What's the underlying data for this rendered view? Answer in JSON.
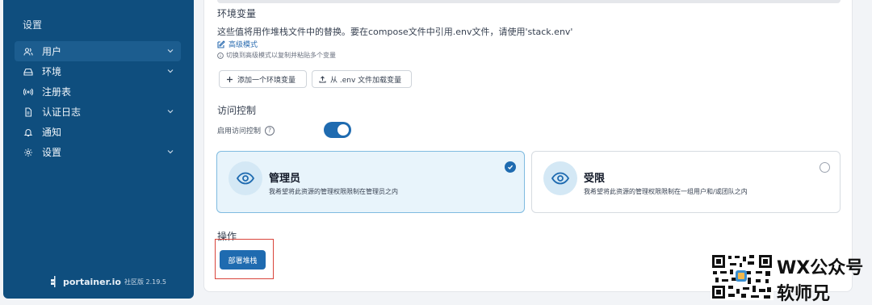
{
  "sidebar": {
    "title": "设置",
    "items": [
      {
        "label": "用户",
        "icon": "users-icon",
        "has_chevron": true,
        "active": true
      },
      {
        "label": "环境",
        "icon": "drive-icon",
        "has_chevron": true,
        "active": false
      },
      {
        "label": "注册表",
        "icon": "broadcast-icon",
        "has_chevron": false,
        "active": false
      },
      {
        "label": "认证日志",
        "icon": "file-icon",
        "has_chevron": true,
        "active": false
      },
      {
        "label": "通知",
        "icon": "bell-icon",
        "has_chevron": false,
        "active": false
      },
      {
        "label": "设置",
        "icon": "gear-icon",
        "has_chevron": true,
        "active": false
      }
    ],
    "brand": {
      "name": "portainer.io",
      "edition": "社区版 2.19.5"
    }
  },
  "env": {
    "title": "环境变量",
    "description": "这些值将用作堆栈文件中的替换。要在compose文件中引用.env文件，请使用'stack.env'",
    "advanced_link": "高级模式",
    "hint": "切换到高级模式以复制并粘贴多个变量",
    "add_button": "添加一个环境变量",
    "load_button": "从 .env 文件加载变量"
  },
  "access": {
    "title": "访问控制",
    "toggle_label": "启用访问控制",
    "toggle_on": true,
    "cards": [
      {
        "title": "管理员",
        "subtitle": "我希望将此资源的管理权限限制在管理员之内",
        "selected": true
      },
      {
        "title": "受限",
        "subtitle": "我希望将此资源的管理权限限制在一组用户和/或团队之内",
        "selected": false
      }
    ]
  },
  "actions": {
    "title": "操作",
    "deploy_button": "部署堆栈"
  },
  "watermark": {
    "line1": "WX公众号",
    "line2": "软师兄"
  },
  "colors": {
    "sidebar_bg": "#0f4e7e",
    "accent": "#1f6bb0",
    "highlight_border": "#d9443b"
  }
}
